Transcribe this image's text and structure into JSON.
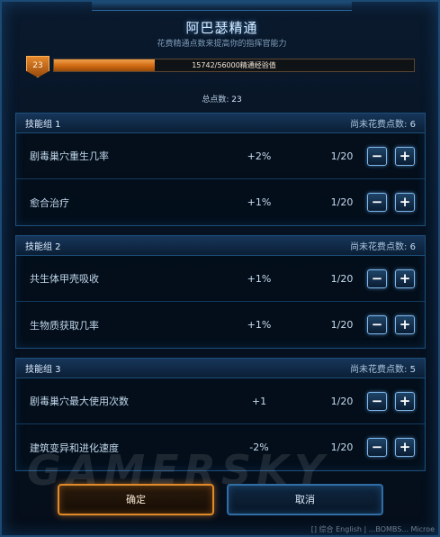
{
  "window": {
    "title": "阿巴瑟精通",
    "subtitle": "花费精通点数来提高你的指挥官能力"
  },
  "level": {
    "value": "23",
    "xp_text": "15742/56000精通经验值",
    "xp_fraction": 0.281
  },
  "total_points": {
    "label": "总点数:",
    "value": "23"
  },
  "groups": [
    {
      "name": "技能组 1",
      "remaining_label": "尚未花费点数:",
      "remaining_value": "6",
      "skills": [
        {
          "name": "剧毒巢穴重生几率",
          "bonus": "+2%",
          "count": "1/20"
        },
        {
          "name": "愈合治疗",
          "bonus": "+1%",
          "count": "1/20"
        }
      ]
    },
    {
      "name": "技能组 2",
      "remaining_label": "尚未花费点数:",
      "remaining_value": "6",
      "skills": [
        {
          "name": "共生体甲壳吸收",
          "bonus": "+1%",
          "count": "1/20"
        },
        {
          "name": "生物质获取几率",
          "bonus": "+1%",
          "count": "1/20"
        }
      ]
    },
    {
      "name": "技能组 3",
      "remaining_label": "尚未花费点数:",
      "remaining_value": "5",
      "skills": [
        {
          "name": "剧毒巢穴最大使用次数",
          "bonus": "+1",
          "count": "1/20"
        },
        {
          "name": "建筑变异和进化速度",
          "bonus": "-2%",
          "count": "1/20"
        }
      ]
    }
  ],
  "buttons": {
    "minus_glyph": "−",
    "plus_glyph": "+",
    "confirm_label": "确定",
    "cancel_label": "取消"
  },
  "watermark": "GAMERSKY",
  "footer": "[] 综合 English | ...BOMBS... Microe",
  "colors": {
    "accent_orange": "#e08a2a",
    "frame_blue": "#1c4f7b",
    "xp_fill": "#d06a12"
  }
}
